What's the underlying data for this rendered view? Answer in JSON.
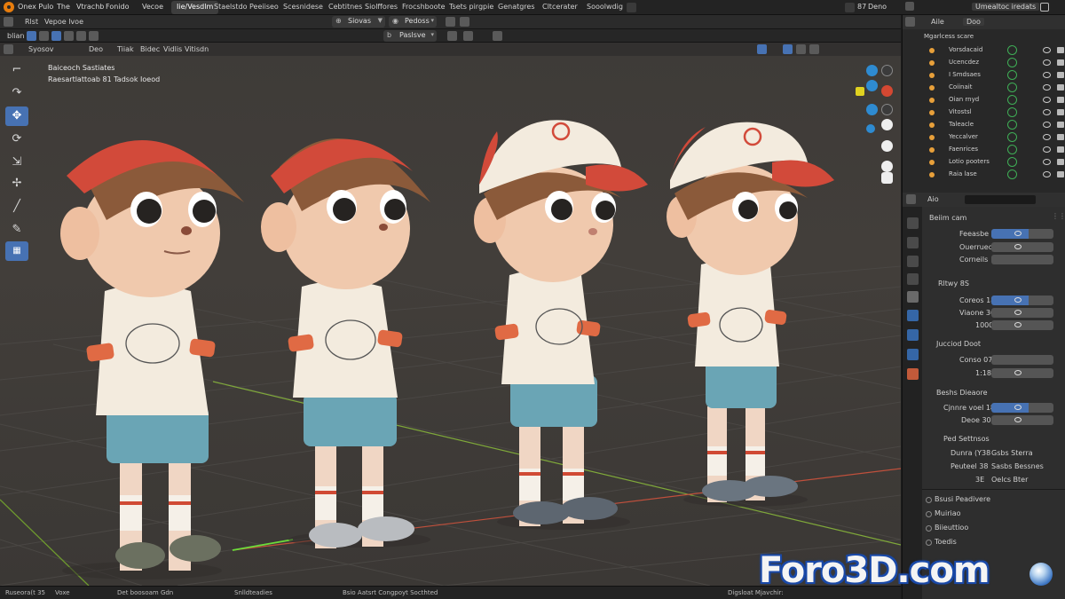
{
  "menubar": {
    "items": [
      "Onex Pulo",
      "The",
      "Vtrachb",
      "Fonido",
      "Vecoe"
    ],
    "workspace_tabs": [
      "Iie/Vesdlm",
      "Staelstdo",
      "Peeiiseo",
      "Scesnidese",
      "Cebtitnes",
      "Siolffores",
      "Frocshboote",
      "Tsets pirgpie",
      "Genatgres",
      "Cltcerater",
      "Sooolwdig"
    ],
    "right_items": [
      "87",
      "Deno"
    ],
    "right_fields": [
      "Umealtoc iredats"
    ]
  },
  "header2": {
    "left_items": [
      "Rlst",
      "Vepoe lvoe"
    ],
    "mode_dropdown": "Siovas",
    "view_dropdown": "Pedoss"
  },
  "header3": {
    "label": "blian",
    "shading_dropdown": "Paslsve"
  },
  "viewport_header": {
    "items": [
      "Syosov",
      "Deo",
      "Tiiak",
      "Bidec",
      "Vidlis",
      "Vitisdn"
    ]
  },
  "viewport": {
    "overlay_line1": "Baiceoch Sastiates",
    "overlay_line2": "Raesartlattoab 81 Tadsok Ioeod"
  },
  "outliner": {
    "header": "Mgarlcess scare",
    "tabs": [
      "Aile",
      "Doo"
    ],
    "rows": [
      "Vorsdacaid",
      "Ucencdez",
      "I Smdsaes",
      "Coiinait",
      "Oian rnyd",
      "Vitostsl",
      "Taleacle",
      "Yeccalver",
      "Faenrices",
      "Lotio pooters",
      "Raia lase"
    ]
  },
  "properties": {
    "header": "Aio",
    "sections": [
      {
        "title": "Beiim cam",
        "rows": [
          "Feeasbe",
          "Ouerrued",
          "Corneils"
        ]
      },
      {
        "title": "Rltwy 8S",
        "rows": [
          "Coreos 18",
          "Viaone 36",
          "1000"
        ]
      },
      {
        "title": "Jucciod Doot",
        "rows": [
          "Conso 07",
          "1:18"
        ]
      },
      {
        "title": "Beshs Dieaore",
        "rows": [
          "Cjnnre voel 18",
          "Deoe 30"
        ]
      },
      {
        "title": "Ped Settnsos",
        "rows": [
          "Dunra (Y38",
          "Peuteel 38",
          "3E"
        ],
        "values": [
          "Gsbs Sterra",
          "Sasbs Bessnes",
          "Oelcs Bter"
        ]
      }
    ],
    "list_items": [
      "Bsusi Peadivere",
      "Muiriao",
      "Biieuttioo",
      "Toedis"
    ]
  },
  "statusbar": {
    "items": [
      "Ruseora(t 35",
      "Voxe",
      "Det boosoam Gdn",
      "Snlldteadies",
      "Bsio Aatsrt Congpoyt Socthted",
      "Digsloat Mjavchir:"
    ]
  },
  "watermark": {
    "text": "Foro3D.com"
  },
  "colors": {
    "accent": "#4772b3",
    "background": "#3e3b38",
    "panel": "#2b2b2b"
  }
}
